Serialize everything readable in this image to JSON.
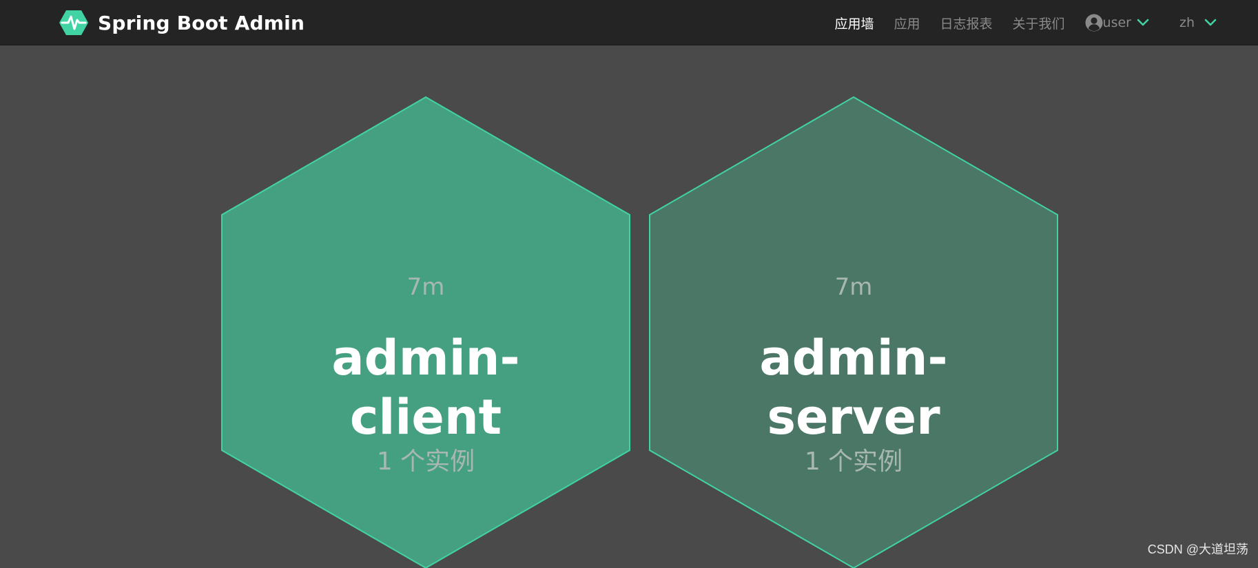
{
  "navbar": {
    "brand_title": "Spring Boot Admin",
    "brand_icon": "heartbeat-hexagon-icon",
    "items": [
      {
        "label": "应用墙",
        "active": true
      },
      {
        "label": "应用",
        "active": false
      },
      {
        "label": "日志报表",
        "active": false
      },
      {
        "label": "关于我们",
        "active": false
      }
    ],
    "user_label": "user",
    "lang_label": "zh"
  },
  "applications": [
    {
      "uptime": "7m",
      "name_line1": "admin-",
      "name_line2": "client",
      "instances": "1 个实例"
    },
    {
      "uptime": "7m",
      "name_line1": "admin-",
      "name_line2": "server",
      "instances": "1 个实例"
    }
  ],
  "watermark": "CSDN @大道坦荡",
  "colors": {
    "navbar_bg": "#242424",
    "page_bg": "#4a4a4a",
    "accent": "#42d3a5",
    "hex_client_fill": "#45a082",
    "hex_server_fill": "#4a7766"
  }
}
